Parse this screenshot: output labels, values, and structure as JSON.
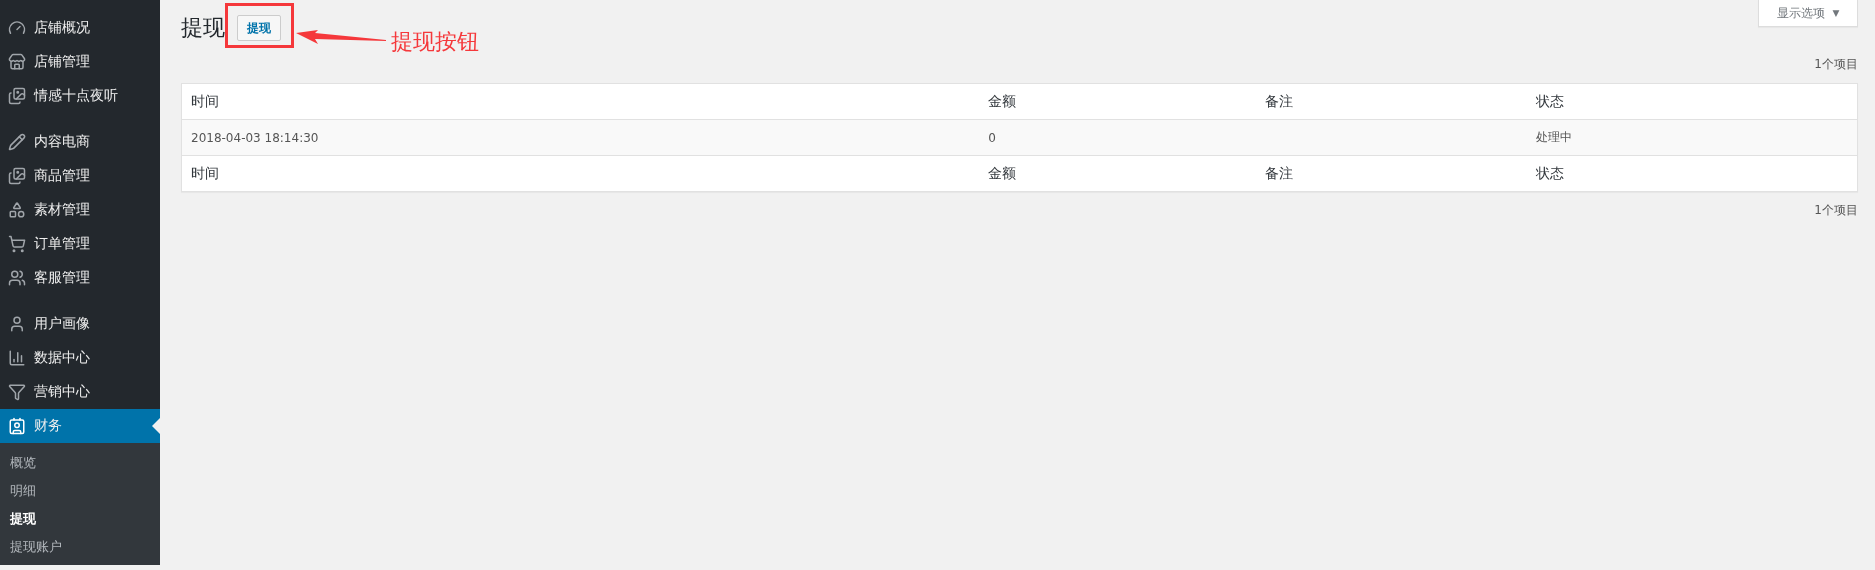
{
  "sidebar": {
    "groups": [
      {
        "items": [
          {
            "label": "店铺概况",
            "selected": false
          },
          {
            "label": "店铺管理",
            "selected": false
          },
          {
            "label": "情感十点夜听",
            "selected": false
          }
        ]
      },
      {
        "items": [
          {
            "label": "内容电商",
            "selected": false
          },
          {
            "label": "商品管理",
            "selected": false
          },
          {
            "label": "素材管理",
            "selected": false
          },
          {
            "label": "订单管理",
            "selected": false
          },
          {
            "label": "客服管理",
            "selected": false
          }
        ]
      },
      {
        "items": [
          {
            "label": "用户画像",
            "selected": false
          },
          {
            "label": "数据中心",
            "selected": false
          },
          {
            "label": "营销中心",
            "selected": false
          },
          {
            "label": "财务",
            "selected": true
          }
        ]
      }
    ],
    "submenu": [
      {
        "label": "概览",
        "selected": false
      },
      {
        "label": "明细",
        "selected": false
      },
      {
        "label": "提现",
        "selected": true
      },
      {
        "label": "提现账户",
        "selected": false
      }
    ]
  },
  "screen_options": {
    "label": "显示选项",
    "caret": "▼"
  },
  "page": {
    "title": "提现",
    "action_button": "提现"
  },
  "annotation": {
    "label": "提现按钮"
  },
  "item_count_top": "1个项目",
  "table": {
    "columns": [
      "时间",
      "金额",
      "备注",
      "状态"
    ],
    "rows": [
      [
        "2018-04-03 18:14:30",
        "0",
        "",
        "处理中"
      ]
    ],
    "footer_columns": [
      "时间",
      "金额",
      "备注",
      "状态"
    ]
  },
  "item_count_bottom": "1个项目"
}
